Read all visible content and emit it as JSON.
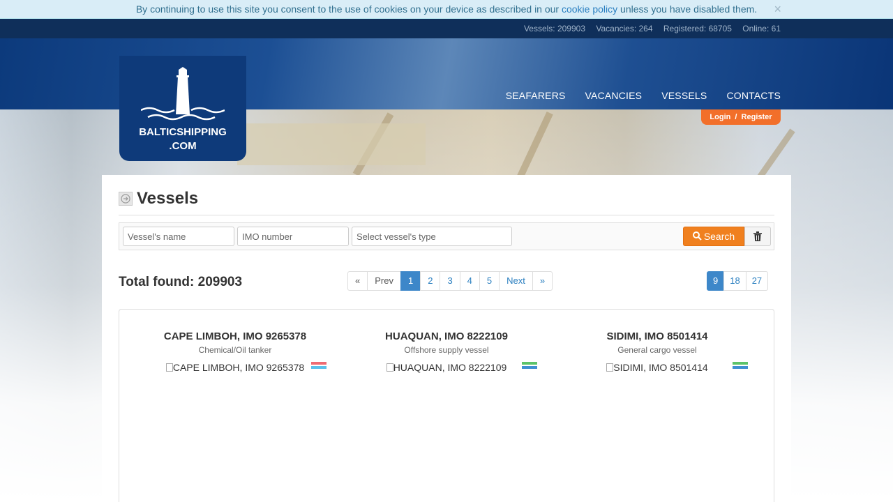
{
  "cookie": {
    "text": "By continuing to use this site you consent to the use of cookies on your device as described in our",
    "link": "cookie policy",
    "text_after": "unless you have disabled them.",
    "close": "×"
  },
  "stats": {
    "vessels": "Vessels: 209903",
    "vacancies": "Vacancies: 264",
    "registered": "Registered: 68705",
    "online": "Online: 61"
  },
  "logo": {
    "line1": "BALTICSHIPPING",
    "line2": ".COM"
  },
  "nav": [
    "SEAFARERS",
    "VACANCIES",
    "VESSELS",
    "CONTACTS"
  ],
  "auth": {
    "login": "Login",
    "sep": "/",
    "register": "Register"
  },
  "page": {
    "title": "Vessels"
  },
  "filters": {
    "name_placeholder": "Vessel's name",
    "imo_placeholder": "IMO number",
    "type_placeholder": "Select vessel's type",
    "search_label": "Search"
  },
  "total": {
    "label": "Total found:",
    "value": "209903"
  },
  "pager": [
    "«",
    "Prev",
    "1",
    "2",
    "3",
    "4",
    "5",
    "Next",
    "»"
  ],
  "pager_active": "1",
  "per_page": [
    "9",
    "18",
    "27"
  ],
  "per_page_active": "9",
  "vessels": [
    {
      "name": "CAPE LIMBOH, IMO 9265378",
      "type": "Chemical/Oil tanker",
      "img_alt": "CAPE LIMBOH, IMO 9265378",
      "flag": [
        "#ef6b73",
        "#5bc0eb"
      ]
    },
    {
      "name": "HUAQUAN, IMO 8222109",
      "type": "Offshore supply vessel",
      "img_alt": "HUAQUAN, IMO 8222109",
      "flag": [
        "#5cc36a",
        "#3f8fd2"
      ]
    },
    {
      "name": "SIDIMI, IMO 8501414",
      "type": "General cargo vessel",
      "img_alt": "SIDIMI, IMO 8501414",
      "flag": [
        "#5cc36a",
        "#3f8fd2"
      ]
    }
  ],
  "colors": {
    "accent": "#f0801f",
    "header": "#0e3a7a",
    "link": "#2a7fc0"
  }
}
